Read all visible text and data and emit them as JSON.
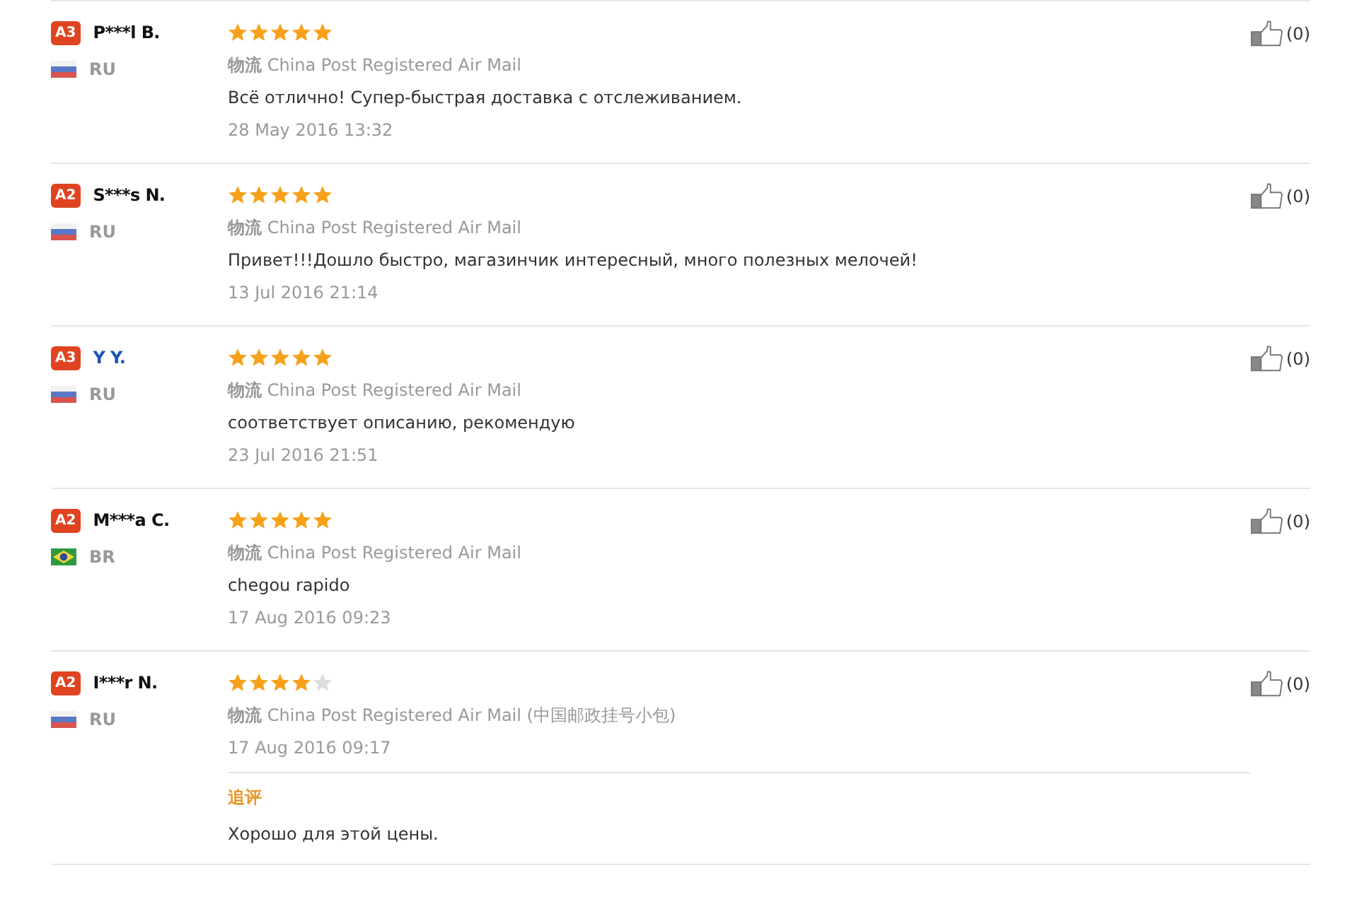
{
  "reviews": [
    {
      "level_badge": "A3",
      "name": "P***l B.",
      "name_link": false,
      "flag": {
        "kind": "russia"
      },
      "country": "RU",
      "stars": 5,
      "logistics_label": "物流",
      "logistics": "China Post Registered Air Mail",
      "text": "Всё отлично! Супер-быстрая доставка с отслеживанием.",
      "date": "28 May 2016 13:32",
      "likes": "(0)"
    },
    {
      "level_badge": "A2",
      "name": "S***s N.",
      "name_link": false,
      "flag": {
        "kind": "russia"
      },
      "country": "RU",
      "stars": 5,
      "logistics_label": "物流",
      "logistics": "China Post Registered Air Mail",
      "text": "Привет!!!Дошло быстро, магазинчик интересный, много полезных мелочей!",
      "date": "13 Jul 2016 21:14",
      "likes": "(0)"
    },
    {
      "level_badge": "A3",
      "name": "Y Y.",
      "name_link": true,
      "flag": {
        "kind": "russia"
      },
      "country": "RU",
      "stars": 5,
      "logistics_label": "物流",
      "logistics": "China Post Registered Air Mail",
      "text": "соответствует описанию, рекомендую",
      "date": "23 Jul 2016 21:51",
      "likes": "(0)"
    },
    {
      "level_badge": "A2",
      "name": "M***a C.",
      "name_link": false,
      "flag": {
        "kind": "brazil"
      },
      "country": "BR",
      "stars": 5,
      "logistics_label": "物流",
      "logistics": "China Post Registered Air Mail",
      "text": "chegou rapido",
      "date": "17 Aug 2016 09:23",
      "likes": "(0)"
    },
    {
      "level_badge": "A2",
      "name": "I***r N.",
      "name_link": false,
      "flag": {
        "kind": "russia"
      },
      "country": "RU",
      "stars": 4,
      "logistics_label": "物流",
      "logistics": "China Post Registered Air Mail (中国邮政挂号小包)",
      "date": "17 Aug 2016 09:17",
      "likes": "(0)",
      "followup": {
        "label": "追评",
        "text": "Хорошо для этой цены."
      }
    }
  ]
}
